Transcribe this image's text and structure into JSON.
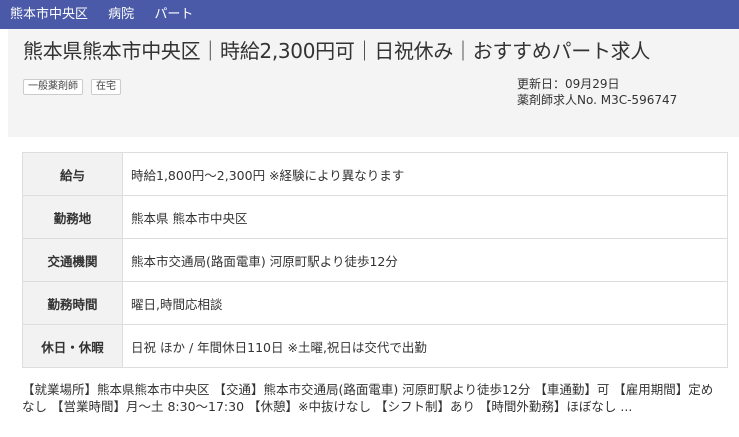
{
  "breadcrumb": [
    "熊本市中央区",
    "病院",
    "パート"
  ],
  "header": {
    "title": "熊本県熊本市中央区｜時給2,300円可｜日祝休み｜おすすめパート求人",
    "tags": [
      "一般薬剤師",
      "在宅"
    ],
    "updated": "更新日：09月29日",
    "job_number": "薬剤師求人No. M3C-596747"
  },
  "details": [
    {
      "label": "給与",
      "value": "時給1,800円〜2,300円 ※経験により異なります"
    },
    {
      "label": "勤務地",
      "value": "熊本県 熊本市中央区"
    },
    {
      "label": "交通機関",
      "value": "熊本市交通局(路面電車) 河原町駅より徒歩12分"
    },
    {
      "label": "勤務時間",
      "value": "曜日,時間応相談"
    },
    {
      "label": "休日・休暇",
      "value": "日祝 ほか / 年間休日110日 ※土曜,祝日は交代で出勤"
    }
  ],
  "description": "【就業場所】熊本県熊本市中央区 【交通】熊本市交通局(路面電車) 河原町駅より徒歩12分 【車通勤】可 【雇用期間】定めなし 【営業時間】月〜土 8:30〜17:30 【休憩】※中抜けなし 【シフト制】あり 【時間外勤務】ほぼなし ..."
}
